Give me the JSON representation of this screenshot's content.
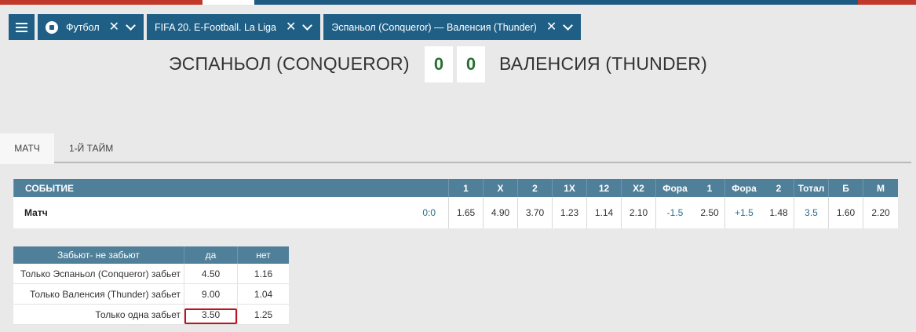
{
  "colors": {
    "nav_bg": "#1f5f86",
    "table_header": "#4f7f99",
    "score_green": "#2a6f35",
    "link_blue": "#2a6f8e",
    "highlight_red": "#c0121c"
  },
  "breadcrumb": {
    "sport": "Футбол",
    "league": "FIFA 20. E-Football. La Liga",
    "match": "Эспаньол (Conqueror) — Валенсия (Thunder)"
  },
  "match": {
    "home_team": "ЭСПАНЬОЛ (CONQUEROR)",
    "away_team": "ВАЛЕНСИЯ (THUNDER)",
    "home_score": "0",
    "away_score": "0"
  },
  "tabs": [
    "МАТЧ",
    "1-Й ТАЙМ"
  ],
  "odds_table": {
    "headers": {
      "event": "СОБЫТИЕ",
      "c1": "1",
      "cx": "X",
      "c2": "2",
      "c1x": "1X",
      "c12": "12",
      "cx2": "X2",
      "fora1_label": "Фора",
      "fora1_num": "1",
      "fora2_label": "Фора",
      "fora2_num": "2",
      "total_label": "Тотал",
      "b": "Б",
      "m": "М"
    },
    "row": {
      "event": "Матч",
      "score": "0:0",
      "c1": "1.65",
      "cx": "4.90",
      "c2": "3.70",
      "c1x": "1.23",
      "c12": "1.14",
      "cx2": "2.10",
      "fora1_val": "-1.5",
      "fora1_odds": "2.50",
      "fora2_val": "+1.5",
      "fora2_odds": "1.48",
      "total_val": "3.5",
      "b": "1.60",
      "m": "2.20"
    }
  },
  "score_table": {
    "header": {
      "label": "Забьют- не забьют",
      "yes": "да",
      "no": "нет"
    },
    "rows": [
      {
        "label": "Только Эспаньол (Conqueror) забьет",
        "yes": "4.50",
        "no": "1.16"
      },
      {
        "label": "Только Валенсия (Thunder) забьет",
        "yes": "9.00",
        "no": "1.04"
      },
      {
        "label": "Только одна забьет",
        "yes": "3.50",
        "no": "1.25"
      }
    ]
  }
}
